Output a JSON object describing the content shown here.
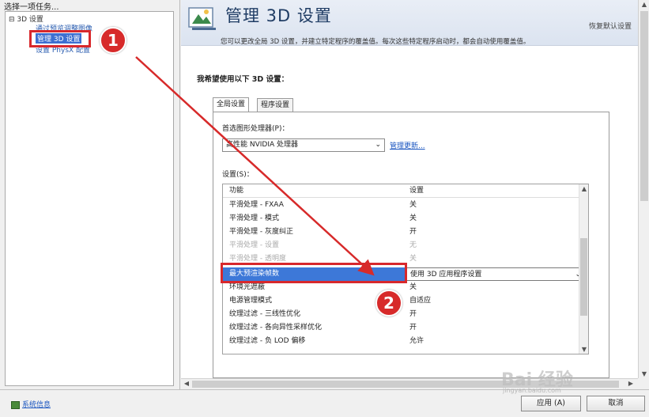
{
  "left_pane": {
    "title": "选择一项任务...",
    "tree": {
      "root": "⊟ 3D 设置",
      "children": [
        "通过预览调整图像",
        "管理 3D 设置",
        "设置 PhysX 配置"
      ]
    }
  },
  "banner": {
    "title": "管理 3D 设置",
    "restore_link": "恢复默认设置",
    "description": "您可以更改全局 3D 设置，并建立特定程序的覆盖值。每次这些特定程序启动时，都会自动使用覆盖值。"
  },
  "section": {
    "title": "我希望使用以下 3D 设置："
  },
  "tabs": [
    {
      "label": "全局设置",
      "active": true
    },
    {
      "label": "程序设置",
      "active": false
    }
  ],
  "gpu": {
    "label": "首选图形处理器(P)：",
    "value": "高性能 NVIDIA 处理器",
    "manage_link": "管理更新..."
  },
  "settings": {
    "label": "设置(S)：",
    "headers": {
      "feature": "功能",
      "value": "设置"
    },
    "rows": [
      {
        "feature": "平滑处理 - FXAA",
        "value": "关",
        "state": "normal"
      },
      {
        "feature": "平滑处理 - 模式",
        "value": "关",
        "state": "normal"
      },
      {
        "feature": "平滑处理 - 灰度纠正",
        "value": "开",
        "state": "normal"
      },
      {
        "feature": "平滑处理 - 设置",
        "value": "无",
        "state": "disabled"
      },
      {
        "feature": "平滑处理 - 透明度",
        "value": "关",
        "state": "disabled"
      },
      {
        "feature": "最大预渲染帧数",
        "value": "使用 3D 应用程序设置",
        "state": "selected"
      },
      {
        "feature": "环境光遮蔽",
        "value": "关",
        "state": "normal"
      },
      {
        "feature": "电源管理模式",
        "value": "自适应",
        "state": "normal"
      },
      {
        "feature": "纹理过滤 - 三线性优化",
        "value": "开",
        "state": "normal"
      },
      {
        "feature": "纹理过滤 - 各向异性采样优化",
        "value": "开",
        "state": "normal"
      },
      {
        "feature": "纹理过滤 - 负 LOD 偏移",
        "value": "允许",
        "state": "normal"
      }
    ]
  },
  "bottom": {
    "sysinfo_link": "系统信息",
    "apply_label": "应用 (A)",
    "cancel_label": "取消"
  },
  "annotations": {
    "badge1": "1",
    "badge2": "2",
    "color": "#d72a2a"
  },
  "watermark": {
    "text": "Bai 经验",
    "sub": "jingyan.baidu.com"
  }
}
